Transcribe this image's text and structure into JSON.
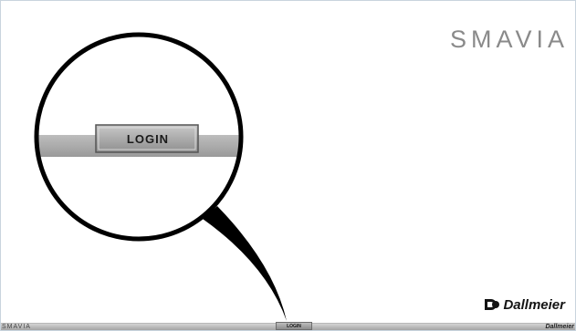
{
  "brand": {
    "logo_text": "SMAVIA",
    "bottom_bar_label": "SMAVIA"
  },
  "company": {
    "logo_text": "Dallmeier",
    "bottom_bar_label": "Dallmeier"
  },
  "zoom_callout": {
    "button_label": "LOGIN"
  },
  "bottom_bar": {
    "login_label": "LOGIN"
  },
  "colors": {
    "background": "#ffffff",
    "brand_gray": "#8a8a8a",
    "bar_gray": "#a8a8a8",
    "callout_outline": "#000000"
  }
}
